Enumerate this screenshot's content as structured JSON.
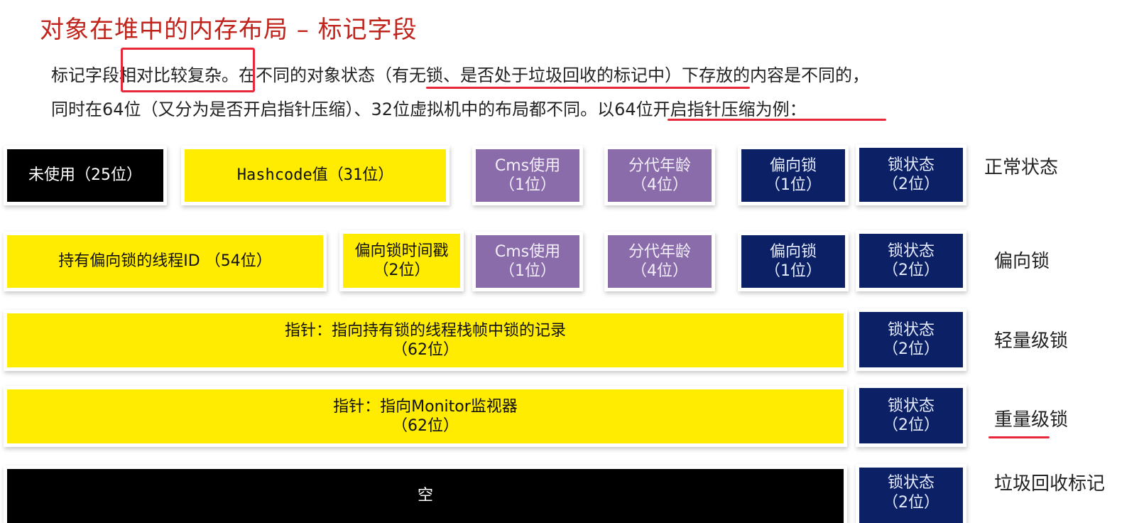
{
  "title": "对象在堆中的内存布局 – 标记字段",
  "paragraph": {
    "line1_a": "标记字段",
    "line1_boxed": "相对比较复杂",
    "line1_b": "。在不同的对象状态",
    "line1_underlined": "（有无锁、是否处于垃圾回收的标记中）",
    "line1_c": "下存放的内容是不同的，",
    "line2_a": "同时在64位（又分为是否开启指针压缩）、32位虚拟机中的布局都不同。",
    "line2_underlined": "以64位开启指针压缩为例",
    "line2_b": "："
  },
  "rows": [
    {
      "label": "正常状态",
      "cells": [
        {
          "line1": "未使用（25位）",
          "line2": ""
        },
        {
          "line1": "Hashcode值（31位）",
          "line2": ""
        },
        {
          "line1": "Cms使用",
          "line2": "（1位）"
        },
        {
          "line1": "分代年龄",
          "line2": "（4位）"
        },
        {
          "line1": "偏向锁",
          "line2": "（1位）"
        },
        {
          "line1": "锁状态",
          "line2": "（2位）"
        }
      ]
    },
    {
      "label": "偏向锁",
      "cells": [
        {
          "line1": "持有偏向锁的线程ID （54位）",
          "line2": ""
        },
        {
          "line1": "偏向锁时间戳",
          "line2": "（2位）"
        },
        {
          "line1": "Cms使用",
          "line2": "（1位）"
        },
        {
          "line1": "分代年龄",
          "line2": "（4位）"
        },
        {
          "line1": "偏向锁",
          "line2": "（1位）"
        },
        {
          "line1": "锁状态",
          "line2": "（2位）"
        }
      ]
    },
    {
      "label": "轻量级锁",
      "cells": [
        {
          "line1": "指针：指向持有锁的线程栈帧中锁的记录",
          "line2": "（62位）"
        },
        {
          "line1": "锁状态",
          "line2": "（2位）"
        }
      ]
    },
    {
      "label": "重量级锁",
      "cells": [
        {
          "line1": "指针：指向Monitor监视器",
          "line2": "（62位）"
        },
        {
          "line1": "锁状态",
          "line2": "（2位）"
        }
      ]
    },
    {
      "label": "垃圾回收标记",
      "cells": [
        {
          "line1": "空",
          "line2": ""
        },
        {
          "line1": "锁状态",
          "line2": "（2位）"
        }
      ]
    }
  ],
  "colors": {
    "title": "#c0241c",
    "highlight": "#e8283a",
    "black": "#000000",
    "yellow": "#ffec00",
    "purple": "#8a6cab",
    "navy": "#0c2165"
  }
}
